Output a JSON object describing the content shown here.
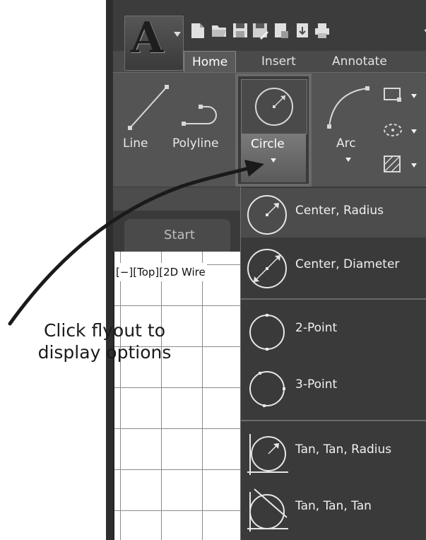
{
  "ribbon": {
    "tabs": [
      "Home",
      "Insert",
      "Annotate"
    ],
    "active_tab": "Home",
    "tools": {
      "line": "Line",
      "polyline": "Polyline",
      "circle": "Circle",
      "arc": "Arc"
    }
  },
  "file_tabs": {
    "start": "Start"
  },
  "viewport": {
    "label": "[−][Top][2D Wire"
  },
  "flyout": {
    "items": [
      {
        "label": "Center, Radius",
        "icon": "circle-center-radius-icon"
      },
      {
        "label": "Center, Diameter",
        "icon": "circle-center-diameter-icon"
      },
      {
        "label": "2-Point",
        "icon": "circle-2-point-icon"
      },
      {
        "label": "3-Point",
        "icon": "circle-3-point-icon"
      },
      {
        "label": "Tan, Tan, Radius",
        "icon": "circle-tan-tan-radius-icon"
      },
      {
        "label": "Tan, Tan, Tan",
        "icon": "circle-tan-tan-tan-icon"
      }
    ]
  },
  "annotation": {
    "line1": "Click flyout to",
    "line2": "display options"
  },
  "colors": {
    "ribbon_bg": "#545454",
    "flyout_bg": "#3a3a3a",
    "text": "#f0f0f0"
  }
}
